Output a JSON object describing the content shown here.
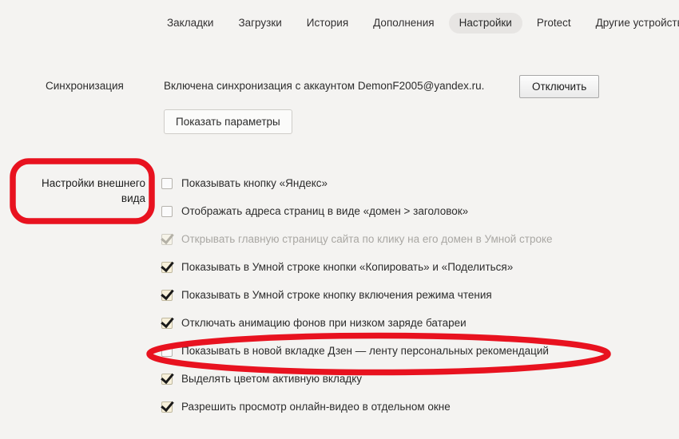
{
  "nav": {
    "items": [
      {
        "label": "Закладки",
        "active": false
      },
      {
        "label": "Загрузки",
        "active": false
      },
      {
        "label": "История",
        "active": false
      },
      {
        "label": "Дополнения",
        "active": false
      },
      {
        "label": "Настройки",
        "active": true
      },
      {
        "label": "Protect",
        "active": false
      },
      {
        "label": "Другие устройства",
        "active": false
      }
    ]
  },
  "sync": {
    "label": "Синхронизация",
    "status_text": "Включена синхронизация с аккаунтом DemonF2005@yandex.ru.",
    "disconnect_button": "Отключить",
    "params_button": "Показать параметры"
  },
  "annotations": {
    "color": "#e8121f",
    "appearance_section": {
      "text_line1": "Настройки внешнего",
      "text_line2": "вида",
      "shape": "rounded-rectangle"
    },
    "zen_highlight": {
      "shape": "ellipse"
    }
  },
  "options": [
    {
      "label": "Показывать кнопку «Яндекс»",
      "checked": false,
      "disabled": false
    },
    {
      "label": "Отображать адреса страниц в виде «домен > заголовок»",
      "checked": false,
      "disabled": false
    },
    {
      "label": "Открывать главную страницу сайта по клику на его домен в Умной строке",
      "checked": true,
      "disabled": true
    },
    {
      "label": "Показывать в Умной строке кнопки «Копировать» и «Поделиться»",
      "checked": true,
      "disabled": false
    },
    {
      "label": "Показывать в Умной строке кнопку включения режима чтения",
      "checked": true,
      "disabled": false
    },
    {
      "label": "Отключать анимацию фонов при низком заряде батареи",
      "checked": true,
      "disabled": false
    },
    {
      "label": "Показывать в новой вкладке Дзен — ленту персональных рекомендаций",
      "checked": false,
      "disabled": false
    },
    {
      "label": "Выделять цветом активную вкладку",
      "checked": true,
      "disabled": false
    },
    {
      "label": "Разрешить просмотр онлайн-видео в отдельном окне",
      "checked": true,
      "disabled": false
    }
  ]
}
